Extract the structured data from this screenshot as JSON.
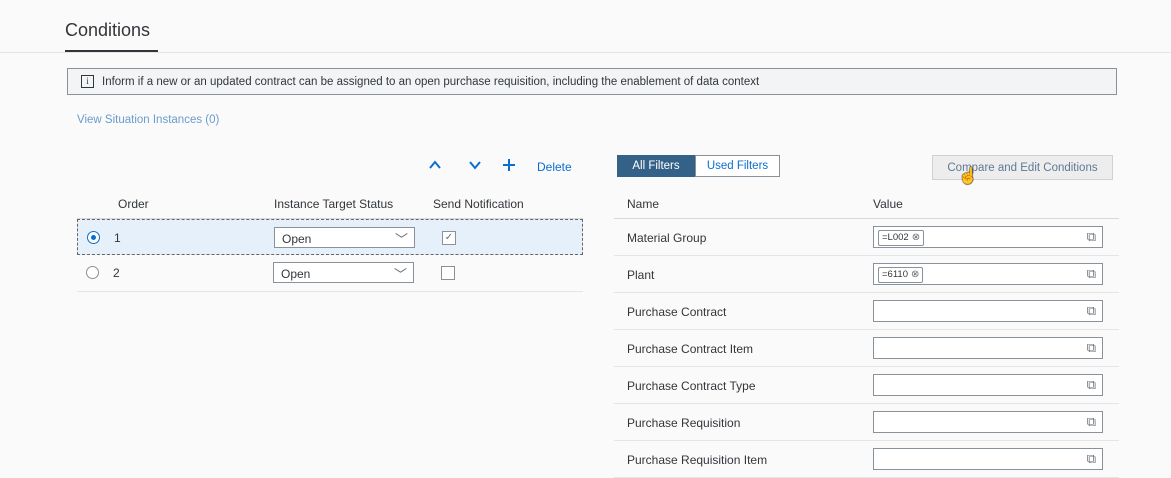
{
  "section": {
    "title": "Conditions"
  },
  "info_strip": {
    "text": "Inform if a new or an updated contract can be assigned to an open purchase requisition, including the enablement of data context"
  },
  "link": {
    "label": "View Situation Instances (0)"
  },
  "toolbar": {
    "up_icon": "chevron-up-icon",
    "down_icon": "chevron-down-icon",
    "add_icon": "plus-icon",
    "delete_label": "Delete"
  },
  "left_table": {
    "columns": [
      "Order",
      "Instance Target Status",
      "Send Notification"
    ],
    "rows": [
      {
        "order": "1",
        "status": "Open",
        "notify": true,
        "selected": true
      },
      {
        "order": "2",
        "status": "Open",
        "notify": false,
        "selected": false
      }
    ]
  },
  "filters": {
    "all_label": "All Filters",
    "used_label": "Used Filters"
  },
  "compare_button": {
    "label": "Compare and Edit Conditions"
  },
  "right_table": {
    "columns": [
      "Name",
      "Value"
    ],
    "rows": [
      {
        "name": "Material Group",
        "token": "=L002"
      },
      {
        "name": "Plant",
        "token": "=6110"
      },
      {
        "name": "Purchase Contract",
        "token": ""
      },
      {
        "name": "Purchase Contract Item",
        "token": ""
      },
      {
        "name": "Purchase Contract Type",
        "token": ""
      },
      {
        "name": "Purchase Requisition",
        "token": ""
      },
      {
        "name": "Purchase Requisition Item",
        "token": ""
      }
    ]
  },
  "colors": {
    "accent": "#0a6ed1",
    "segment_active": "#346187",
    "selected_row": "#e5f0fa"
  }
}
